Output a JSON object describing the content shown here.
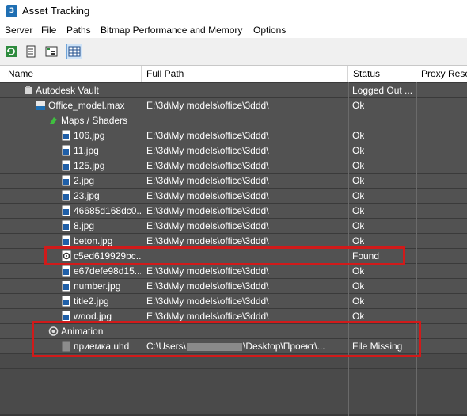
{
  "window": {
    "title": "Asset Tracking"
  },
  "menu": [
    "Server",
    "File",
    "Paths",
    "Bitmap Performance and Memory",
    "Options"
  ],
  "toolbar": {
    "buttons": [
      "refresh-icon",
      "list-icon",
      "tree-icon",
      "table-view-icon"
    ]
  },
  "columns": [
    "Name",
    "Full Path",
    "Status",
    "Proxy Reso"
  ],
  "rows": [
    {
      "name": "Autodesk Vault",
      "path": "",
      "status": "Logged Out ...",
      "icon": "vault-icon"
    },
    {
      "name": "Office_model.max",
      "path": "E:\\3d\\My models\\office\\3ddd\\",
      "status": "Ok",
      "icon": "max-file-icon"
    },
    {
      "name": "Maps / Shaders",
      "path": "",
      "status": "",
      "icon": "maps-icon"
    },
    {
      "name": "106.jpg",
      "path": "E:\\3d\\My models\\office\\3ddd\\",
      "status": "Ok",
      "icon": "image-file-icon"
    },
    {
      "name": "11.jpg",
      "path": "E:\\3d\\My models\\office\\3ddd\\",
      "status": "Ok",
      "icon": "image-file-icon"
    },
    {
      "name": "125.jpg",
      "path": "E:\\3d\\My models\\office\\3ddd\\",
      "status": "Ok",
      "icon": "image-file-icon"
    },
    {
      "name": "2.jpg",
      "path": "E:\\3d\\My models\\office\\3ddd\\",
      "status": "Ok",
      "icon": "image-file-icon"
    },
    {
      "name": "23.jpg",
      "path": "E:\\3d\\My models\\office\\3ddd\\",
      "status": "Ok",
      "icon": "image-file-icon"
    },
    {
      "name": "46685d168dc0...",
      "path": "E:\\3d\\My models\\office\\3ddd\\",
      "status": "Ok",
      "icon": "image-file-icon"
    },
    {
      "name": "8.jpg",
      "path": "E:\\3d\\My models\\office\\3ddd\\",
      "status": "Ok",
      "icon": "image-file-icon"
    },
    {
      "name": "beton.jpg",
      "path": "E:\\3d\\My models\\office\\3ddd\\",
      "status": "Ok",
      "icon": "image-file-icon"
    },
    {
      "name": "c5ed619929bc...",
      "path": "",
      "status": "Found",
      "icon": "found-file-icon"
    },
    {
      "name": "e67defe98d15...",
      "path": "E:\\3d\\My models\\office\\3ddd\\",
      "status": "Ok",
      "icon": "image-file-icon"
    },
    {
      "name": "number.jpg",
      "path": "E:\\3d\\My models\\office\\3ddd\\",
      "status": "Ok",
      "icon": "image-file-icon"
    },
    {
      "name": "title2.jpg",
      "path": "E:\\3d\\My models\\office\\3ddd\\",
      "status": "Ok",
      "icon": "image-file-icon"
    },
    {
      "name": "wood.jpg",
      "path": "E:\\3d\\My models\\office\\3ddd\\",
      "status": "Ok",
      "icon": "image-file-icon"
    },
    {
      "name": "Animation",
      "path": "",
      "status": "",
      "icon": "animation-icon"
    },
    {
      "name": "приемка.uhd",
      "path_prefix": "C:\\Users\\",
      "path_suffix": "\\Desktop\\Проект\\...",
      "status": "File Missing",
      "icon": "missing-file-icon"
    }
  ],
  "colors": {
    "row_bg": "#525252",
    "grid_bg": "#3a3a3a",
    "highlight_border": "#d11a1a"
  }
}
